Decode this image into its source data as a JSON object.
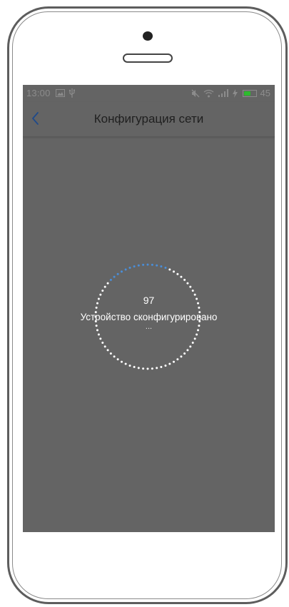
{
  "status_bar": {
    "time": "13:00",
    "battery_level": "45",
    "battery_color": "#2dbb2d"
  },
  "nav": {
    "title": "Конфигурация сети"
  },
  "progress": {
    "value": "97",
    "status_text": "Устройство сконфигурировано",
    "ellipsis": "...",
    "accent_color": "#4a8ed8",
    "dot_color": "#ffffff"
  },
  "colors": {
    "screen_overlay": "#646464",
    "frame": "#5d5d5d"
  }
}
